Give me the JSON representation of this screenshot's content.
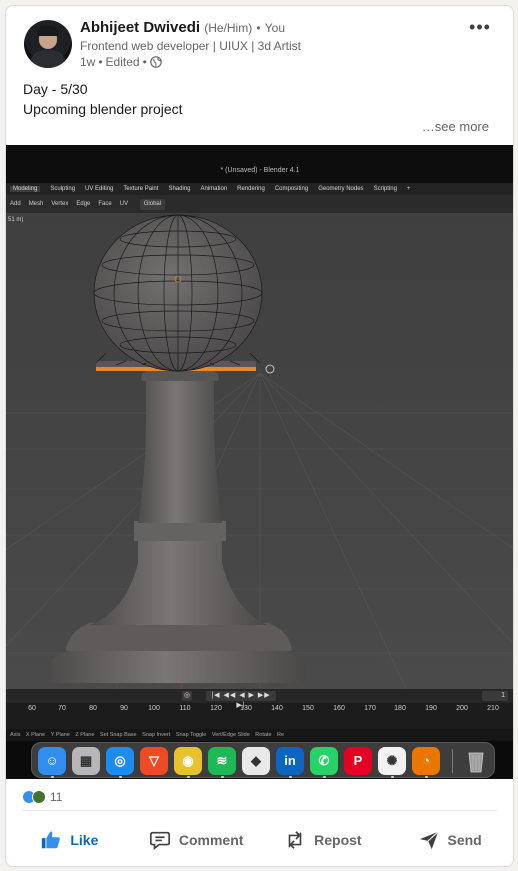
{
  "post": {
    "author": {
      "name": "Abhijeet Dwivedi",
      "pronouns": "(He/Him)",
      "separator": "•",
      "relationship": "You",
      "headline": "Frontend web developer | UIUX | 3d Artist",
      "time": "1w",
      "edited": "Edited"
    },
    "more_menu_icon": "more-horizontal-icon",
    "text": {
      "line1": "Day - 5/30",
      "line2": "Upcoming blender project",
      "see_more": "…see more"
    }
  },
  "blender": {
    "window_title": "* (Unsaved) - Blender 4.1",
    "workspace_tabs": [
      "Modeling",
      "Sculpting",
      "UV Editing",
      "Texture Paint",
      "Shading",
      "Animation",
      "Rendering",
      "Compositing",
      "Geometry Nodes",
      "Scripting",
      "+"
    ],
    "active_tab": "Modeling",
    "header_menu": [
      "Add",
      "Mesh",
      "Vertex",
      "Edge",
      "Face",
      "UV"
    ],
    "transform_orientation": "Global",
    "viewport_label": "51 m)",
    "timeline_frame": "1",
    "timeline_ticks": [
      "60",
      "70",
      "80",
      "90",
      "100",
      "110",
      "120",
      "130",
      "140",
      "150",
      "160",
      "170",
      "180",
      "190",
      "200",
      "210"
    ],
    "status_items": [
      "Axis",
      "X Plane",
      "Y Plane",
      "Z Plane",
      "Set Snap Base",
      "Snap Invert",
      "Snap Toggle",
      "Vert/Edge Slide",
      "Rotate",
      "Re"
    ],
    "playback_controls": "|◀ ◀◀ ◀ ▶ ▶▶ ▶|"
  },
  "dock": {
    "apps": [
      {
        "name": "Finder",
        "icon": "finder-icon",
        "color": "#2f8ef0",
        "glyph": "☺"
      },
      {
        "name": "Launchpad",
        "icon": "launchpad-icon",
        "color": "#b7b7bb",
        "glyph": "▦"
      },
      {
        "name": "Safari",
        "icon": "safari-icon",
        "color": "#1c8cf0",
        "glyph": "◎"
      },
      {
        "name": "Brave",
        "icon": "brave-icon",
        "color": "#f04a24",
        "glyph": "▽"
      },
      {
        "name": "Chrome",
        "icon": "chrome-icon",
        "color": "#e8c22c",
        "glyph": "◉"
      },
      {
        "name": "Spotify",
        "icon": "spotify-icon",
        "color": "#1db954",
        "glyph": "≋"
      },
      {
        "name": "Keynote",
        "icon": "keynote-icon",
        "color": "#e9e9e9",
        "glyph": "◆"
      },
      {
        "name": "LinkedIn",
        "icon": "linkedin-icon",
        "color": "#0a66c2",
        "glyph": "in"
      },
      {
        "name": "WhatsApp",
        "icon": "whatsapp-icon",
        "color": "#25d366",
        "glyph": "✆"
      },
      {
        "name": "Pinterest",
        "icon": "pinterest-icon",
        "color": "#e60023",
        "glyph": "P"
      },
      {
        "name": "ChatGPT",
        "icon": "chatgpt-icon",
        "color": "#f2f2f2",
        "glyph": "✺"
      },
      {
        "name": "Blender",
        "icon": "blender-icon",
        "color": "#ea7600",
        "glyph": "◔"
      }
    ],
    "trash_icon": "trash-icon"
  },
  "social": {
    "reaction_count": "11",
    "reaction_icons": [
      "like-reaction-icon",
      "celebrate-reaction-icon"
    ],
    "actions": [
      {
        "label": "Like",
        "icon": "thumbs-up-icon",
        "active": true,
        "color": "#0a66c2"
      },
      {
        "label": "Comment",
        "icon": "comment-icon",
        "active": false
      },
      {
        "label": "Repost",
        "icon": "repost-icon",
        "active": false
      },
      {
        "label": "Send",
        "icon": "send-icon",
        "active": false
      }
    ]
  }
}
